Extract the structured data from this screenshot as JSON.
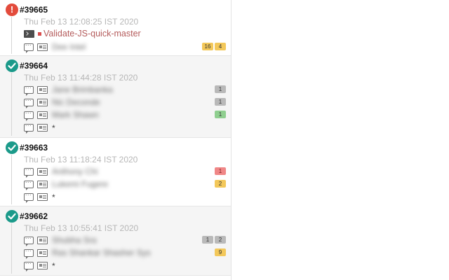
{
  "builds": [
    {
      "number": "#39665",
      "status": "failed",
      "date": "Thu Feb 13 12:08:25 IST 2020",
      "job": "Validate-JS-quick-master",
      "rows": [
        {
          "author": "Dee Intel",
          "badges": [
            {
              "text": "16",
              "color": "yellow"
            },
            {
              "text": "4",
              "color": "yellow"
            }
          ]
        }
      ]
    },
    {
      "number": "#39664",
      "status": "success",
      "date": "Thu Feb 13 11:44:28 IST 2020",
      "rows": [
        {
          "author": "Jane Brimbanka",
          "badges": [
            {
              "text": "1",
              "color": "gray"
            }
          ]
        },
        {
          "author": "Nic Deconde",
          "badges": [
            {
              "text": "1",
              "color": "gray"
            }
          ]
        },
        {
          "author": "Mark Shawn",
          "badges": [
            {
              "text": "1",
              "color": "green"
            }
          ]
        },
        {
          "author": "*",
          "badges": []
        }
      ]
    },
    {
      "number": "#39663",
      "status": "success",
      "date": "Thu Feb 13 11:18:24 IST 2020",
      "rows": [
        {
          "author": "Anthony Chi",
          "badges": [
            {
              "text": "1",
              "color": "red"
            }
          ]
        },
        {
          "author": "Lukemi Fugere",
          "badges": [
            {
              "text": "2",
              "color": "yellow"
            }
          ]
        },
        {
          "author": "*",
          "badges": []
        }
      ]
    },
    {
      "number": "#39662",
      "status": "success",
      "date": "Thu Feb 13 10:55:41 IST 2020",
      "rows": [
        {
          "author": "Shubha Sra",
          "badges": [
            {
              "text": "1",
              "color": "gray"
            },
            {
              "text": "2",
              "color": "gray"
            }
          ]
        },
        {
          "author": "Ras Shankar Shasher Sys",
          "badges": [
            {
              "text": "9",
              "color": "yellow"
            }
          ]
        },
        {
          "author": "*",
          "badges": []
        }
      ]
    }
  ]
}
